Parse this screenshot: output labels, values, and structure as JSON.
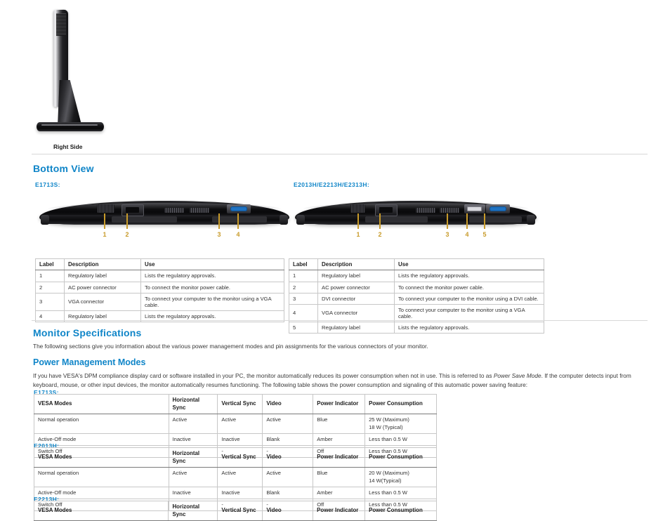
{
  "top": {
    "caption": "Right Side"
  },
  "bottom_view": {
    "heading": "Bottom View",
    "model_left": "E1713S:",
    "model_right": "E2013H/E2213H/E2313H:",
    "callouts_left": [
      "1",
      "2",
      "3",
      "4"
    ],
    "callouts_right": [
      "1",
      "2",
      "3",
      "4",
      "5"
    ],
    "table_headers": [
      "Label",
      "Description",
      "Use"
    ],
    "table_left": [
      [
        "1",
        "Regulatory label",
        "Lists the regulatory approvals."
      ],
      [
        "2",
        "AC power connector",
        "To connect the monitor power cable."
      ],
      [
        "3",
        "VGA connector",
        "To connect your computer to the monitor using a VGA cable."
      ],
      [
        "4",
        "Regulatory label",
        "Lists the regulatory approvals."
      ]
    ],
    "table_right": [
      [
        "1",
        "Regulatory label",
        "Lists the regulatory approvals."
      ],
      [
        "2",
        "AC power connector",
        "To connect the monitor power cable."
      ],
      [
        "3",
        "DVI connector",
        "To connect your computer to the monitor using a DVI cable."
      ],
      [
        "4",
        "VGA connector",
        "To connect your computer to the monitor using a VGA cable."
      ],
      [
        "5",
        "Regulatory label",
        "Lists the regulatory approvals."
      ]
    ]
  },
  "specs": {
    "heading": "Monitor Specifications",
    "intro": "The following sections give you information about the various power management modes and pin assignments for the various connectors of your monitor.",
    "power_heading": "Power Management Modes",
    "power_intro_1": "If you have VESA's DPM compliance display card or software installed in your PC, the monitor automatically reduces its power consumption when not in use. This is referred to as ",
    "power_intro_italic": "Power Save Mode",
    "power_intro_2": ". If the computer detects input from keyboard, mouse, or other input devices, the monitor automatically resumes functioning. The following table shows the power consumption and signaling of this automatic power saving feature:"
  },
  "power_tables": {
    "headers": [
      "VESA Modes",
      "Horizontal Sync",
      "Vertical Sync",
      "Video",
      "Power Indicator",
      "Power Consumption"
    ],
    "tables": [
      {
        "label": "E1713S:",
        "rows": [
          [
            "Normal operation",
            "Active",
            "Active",
            "Active",
            "Blue",
            "25 W (Maximum)\n18 W (Typical)"
          ],
          [
            "Active-Off mode",
            "Inactive",
            "Inactive",
            "Blank",
            "Amber",
            "Less than 0.5 W"
          ],
          [
            "Switch Off",
            "-",
            "-",
            "-",
            "Off",
            "Less than 0.5 W"
          ]
        ]
      },
      {
        "label": "E2013H:",
        "rows": [
          [
            "Normal operation",
            "Active",
            "Active",
            "Active",
            "Blue",
            "20 W (Maximum)\n14 W(Typical)"
          ],
          [
            "Active-Off mode",
            "Inactive",
            "Inactive",
            "Blank",
            "Amber",
            "Less than 0.5 W"
          ],
          [
            "Switch Off",
            "-",
            "-",
            "-",
            "Off",
            "Less than 0.5 W"
          ]
        ]
      },
      {
        "label": "E2213H:",
        "rows": []
      }
    ]
  },
  "colors": {
    "heading_blue": "#0f85c8",
    "callout_gold": "#c89b2a",
    "rule_gray": "#d8d8d8"
  }
}
